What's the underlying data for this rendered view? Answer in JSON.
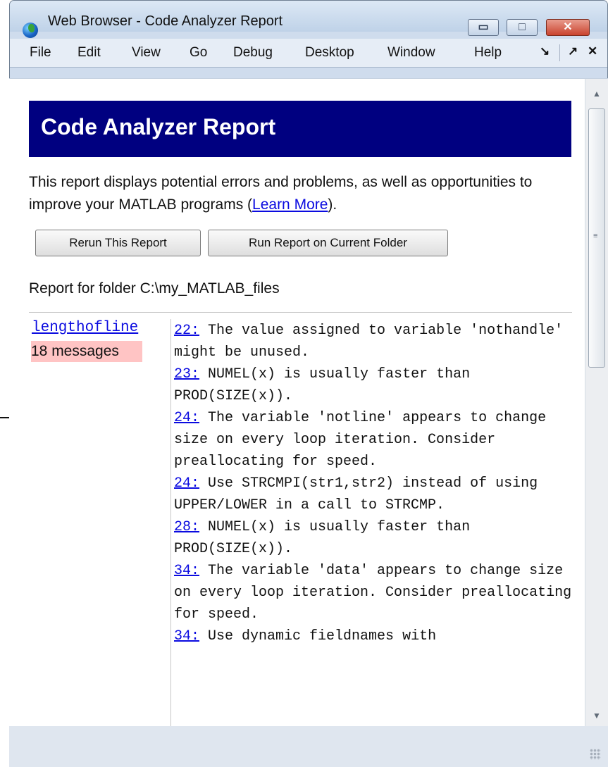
{
  "window": {
    "title": "Web Browser - Code Analyzer Report",
    "controls": {
      "minimize": "▭",
      "maximize": "□",
      "close": "✕"
    }
  },
  "menubar": {
    "items": [
      "File",
      "Edit",
      "View",
      "Go",
      "Debug",
      "Desktop",
      "Window",
      "Help"
    ],
    "undock_glyph": "↘",
    "restore_glyph": "↗",
    "close_glyph": "✕"
  },
  "report": {
    "heading": "Code Analyzer Report",
    "intro": "This report displays potential errors and problems, as well as opportunities to improve your MATLAB programs (",
    "learn_more": "Learn More",
    "intro_end": ").",
    "buttons": {
      "rerun": "Rerun This Report",
      "run_folder": "Run Report on Current Folder"
    },
    "folder_line": "Report for folder C:\\my_MATLAB_files",
    "file": {
      "name": "lengthofline",
      "count": "18 messages"
    },
    "messages": [
      {
        "line": "22:",
        "text": " The value assigned to variable 'nothandle' might be unused."
      },
      {
        "line": "23:",
        "text": " NUMEL(x) is usually faster than PROD(SIZE(x))."
      },
      {
        "line": "24:",
        "text": " The variable 'notline' appears to change size on every loop iteration. Consider preallocating for speed."
      },
      {
        "line": "24:",
        "text": " Use STRCMPI(str1,str2) instead of using UPPER/LOWER in a call to STRCMP."
      },
      {
        "line": "28:",
        "text": " NUMEL(x) is usually faster than PROD(SIZE(x))."
      },
      {
        "line": "34:",
        "text": " The variable 'data' appears to change size on every loop iteration. Consider preallocating for speed."
      },
      {
        "line": "34:",
        "text": " Use dynamic fieldnames with"
      }
    ]
  },
  "colors": {
    "banner": "#000080",
    "link": "#0b0be0",
    "badge": "#ffc4c4",
    "close_button": "#c9432e"
  },
  "icons": {
    "app": "globe-icon",
    "scroll_up": "up-arrow-icon",
    "scroll_down": "down-arrow-icon",
    "resize": "resize-grip-icon"
  }
}
